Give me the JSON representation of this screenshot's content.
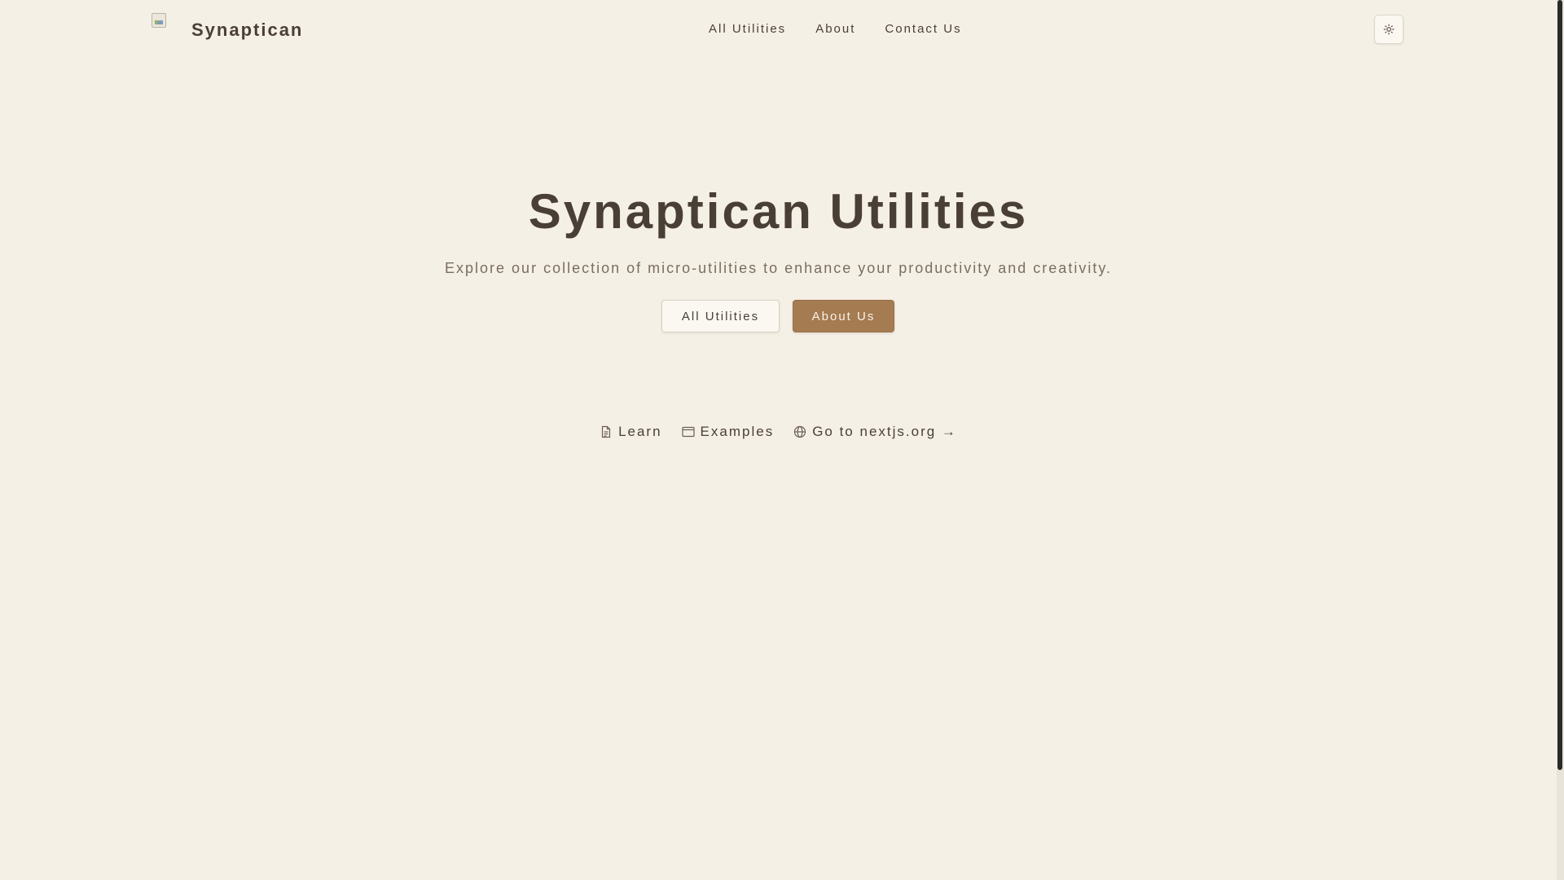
{
  "header": {
    "brand": "Synaptican",
    "nav": [
      "All Utilities",
      "About",
      "Contact Us"
    ],
    "theme_icon": "sun-icon"
  },
  "hero": {
    "title": "Synaptican Utilities",
    "subtitle": "Explore our collection of micro-utilities to enhance your productivity and creativity.",
    "primary_button": "All Utilities",
    "secondary_button": "About Us"
  },
  "footer_links": [
    {
      "label": "Learn",
      "icon": "document-icon"
    },
    {
      "label": "Examples",
      "icon": "window-icon"
    },
    {
      "label": "Go to nextjs.org →",
      "icon": "globe-icon"
    }
  ],
  "colors": {
    "background": "#f5f0e6",
    "text": "#4a3f35",
    "muted_text": "#7a6d5f",
    "accent": "#a57b52"
  }
}
